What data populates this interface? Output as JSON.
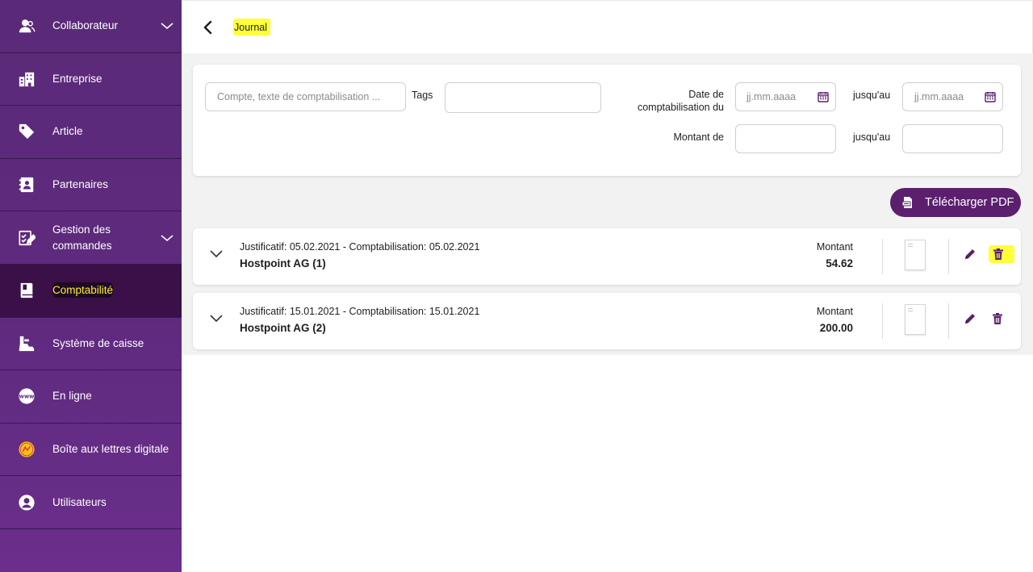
{
  "sidebar": {
    "items": [
      {
        "label": "Collaborateur",
        "icon": "users-icon",
        "expandable": true
      },
      {
        "label": "Entreprise",
        "icon": "building-icon"
      },
      {
        "label": "Article",
        "icon": "tag-icon"
      },
      {
        "label": "Partenaires",
        "icon": "contacts-book-icon"
      },
      {
        "label": "Gestion des commandes",
        "icon": "checklist-edit-icon",
        "expandable": true
      },
      {
        "label": "Comptabilité",
        "icon": "ledger-book-icon",
        "active": true
      },
      {
        "label": "Système de caisse",
        "icon": "cash-register-icon"
      },
      {
        "label": "En ligne",
        "icon": "www-globe-icon"
      },
      {
        "label": "Boîte aux lettres digitale",
        "icon": "mailbox-logo-icon"
      },
      {
        "label": "Utilisateurs",
        "icon": "user-circle-icon"
      }
    ]
  },
  "header": {
    "title": "Journal"
  },
  "filters": {
    "search_placeholder": "Compte, texte de comptabilisation ...",
    "tags_label": "Tags",
    "date_from_label_line1": "Date de",
    "date_from_label_line2": "comptabilisation du",
    "date_placeholder": "jj.mm.aaaa",
    "until_label": "jusqu'au",
    "amount_from_label": "Montant de"
  },
  "actions": {
    "download_pdf": "Télécharger PDF"
  },
  "entries": [
    {
      "meta": "Justificatif: 05.02.2021 - Comptabilisation: 05.02.2021",
      "name": "Hostpoint AG (1)",
      "amount_label": "Montant",
      "amount": "54.62"
    },
    {
      "meta": "Justificatif: 15.01.2021 - Comptabilisation: 15.01.2021",
      "name": "Hostpoint AG (2)",
      "amount_label": "Montant",
      "amount": "200.00"
    }
  ],
  "colors": {
    "sidebar": "#5f2a7e",
    "sidebar_active": "#3b0f47",
    "accent": "#5b1f6e",
    "highlight": "#ffff3a"
  }
}
